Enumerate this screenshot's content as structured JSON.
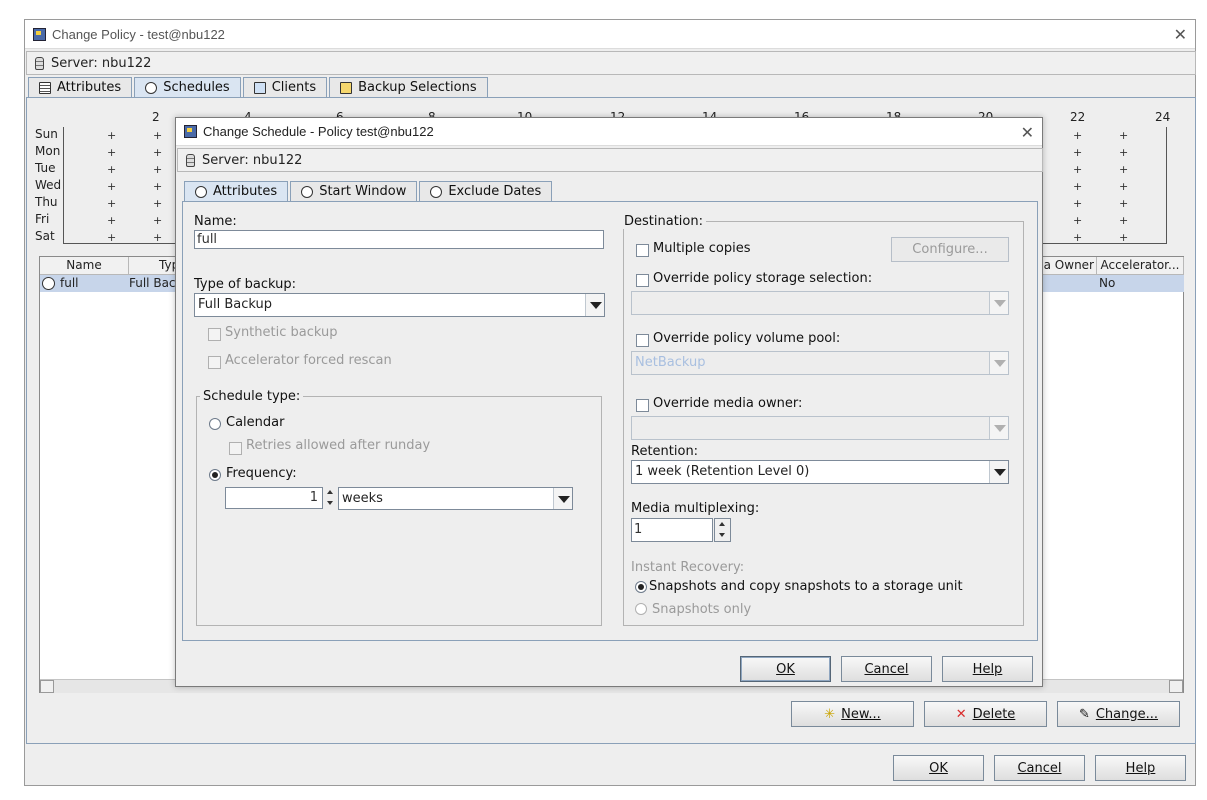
{
  "main_window": {
    "title": "Change Policy - test@nbu122",
    "server_label": "Server: nbu122",
    "tabs": [
      {
        "label": "Attributes"
      },
      {
        "label": "Schedules"
      },
      {
        "label": "Clients"
      },
      {
        "label": "Backup Selections"
      }
    ],
    "active_tab": "Schedules",
    "schedule_grid": {
      "days": [
        "Sun",
        "Mon",
        "Tue",
        "Wed",
        "Thu",
        "Fri",
        "Sat"
      ],
      "hours_left": [
        "2",
        "4",
        "6",
        "8",
        "10",
        "12",
        "14",
        "16",
        "18",
        "20",
        "22",
        "24"
      ],
      "plus_symbol": "+"
    },
    "schedule_list": {
      "columns": [
        "Name",
        "Typ",
        "a Owner",
        "Accelerator..."
      ],
      "rows": [
        {
          "name": "full",
          "type": "Full Bac",
          "owner": "",
          "accelerator": "No"
        }
      ]
    },
    "list_buttons": {
      "new": "New...",
      "delete": "Delete",
      "change": "Change..."
    },
    "footer_buttons": {
      "ok": "OK",
      "cancel": "Cancel",
      "help": "Help"
    }
  },
  "dialog": {
    "title": "Change Schedule - Policy test@nbu122",
    "server_label": "Server: nbu122",
    "tabs": [
      {
        "label": "Attributes"
      },
      {
        "label": "Start Window"
      },
      {
        "label": "Exclude Dates"
      }
    ],
    "active_tab": "Attributes",
    "name_label": "Name:",
    "name_value": "full",
    "type_of_backup_label": "Type of backup:",
    "type_of_backup_value": "Full Backup",
    "synthetic_backup": {
      "label": "Synthetic backup",
      "checked": false,
      "enabled": false
    },
    "accelerator_rescan": {
      "label": "Accelerator forced rescan",
      "checked": false,
      "enabled": false
    },
    "schedule_type": {
      "title": "Schedule type:",
      "calendar_label": "Calendar",
      "retries_label": "Retries allowed after runday",
      "frequency_label": "Frequency:",
      "selected": "Frequency",
      "frequency_value": "1",
      "frequency_unit": "weeks"
    },
    "destination": {
      "title": "Destination:",
      "multiple_copies": {
        "label": "Multiple copies",
        "checked": false
      },
      "configure_button": "Configure...",
      "override_storage": {
        "label": "Override policy storage selection:",
        "checked": false
      },
      "storage_value": "",
      "override_volume_pool": {
        "label": "Override policy volume pool:",
        "checked": false
      },
      "volume_pool_value": "NetBackup",
      "override_media_owner": {
        "label": "Override media owner:",
        "checked": false
      },
      "media_owner_value": "",
      "retention_label": "Retention:",
      "retention_value": "1 week (Retention Level 0)",
      "multiplexing_label": "Media multiplexing:",
      "multiplexing_value": "1",
      "instant_recovery_label": "Instant Recovery:",
      "ir_option_1": "Snapshots and copy snapshots to a storage unit",
      "ir_option_2": "Snapshots only",
      "ir_selected": "Snapshots and copy snapshots to a storage unit"
    },
    "buttons": {
      "ok": "OK",
      "cancel": "Cancel",
      "help": "Help"
    }
  },
  "colors": {
    "tab_active": "#dae5f2",
    "selection": "#c7d5ea",
    "disabled_text": "#9a9a9a",
    "delete_icon": "#d92b2b"
  }
}
